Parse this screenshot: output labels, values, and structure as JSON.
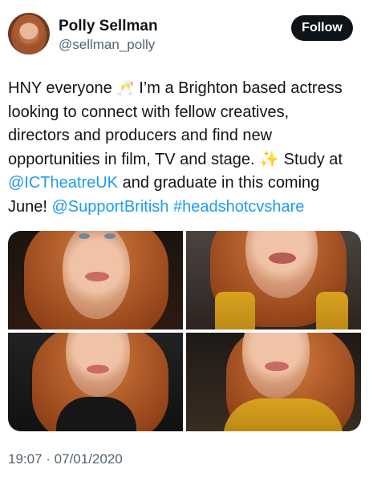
{
  "user": {
    "display_name": "Polly Sellman",
    "handle": "@sellman_polly"
  },
  "follow_button": {
    "label": "Follow"
  },
  "tweet": {
    "seg1": "HNY everyone ",
    "seg2": "🥂",
    "seg3": " I’m a Brighton based actress\nlooking to connect with fellow creatives,\ndirectors and producers and find new\nopportunities in film, TV and stage. ",
    "sparkle": "✨",
    "seg4": " Study at\n",
    "mention1": "@ICTheatreUK",
    "seg5": " and graduate in this coming\nJune! ",
    "mention2": "@SupportBritish",
    "seg6": " ",
    "hashtag": "#headshotcvshare"
  },
  "timestamp": "19:07 · 07/01/2020"
}
